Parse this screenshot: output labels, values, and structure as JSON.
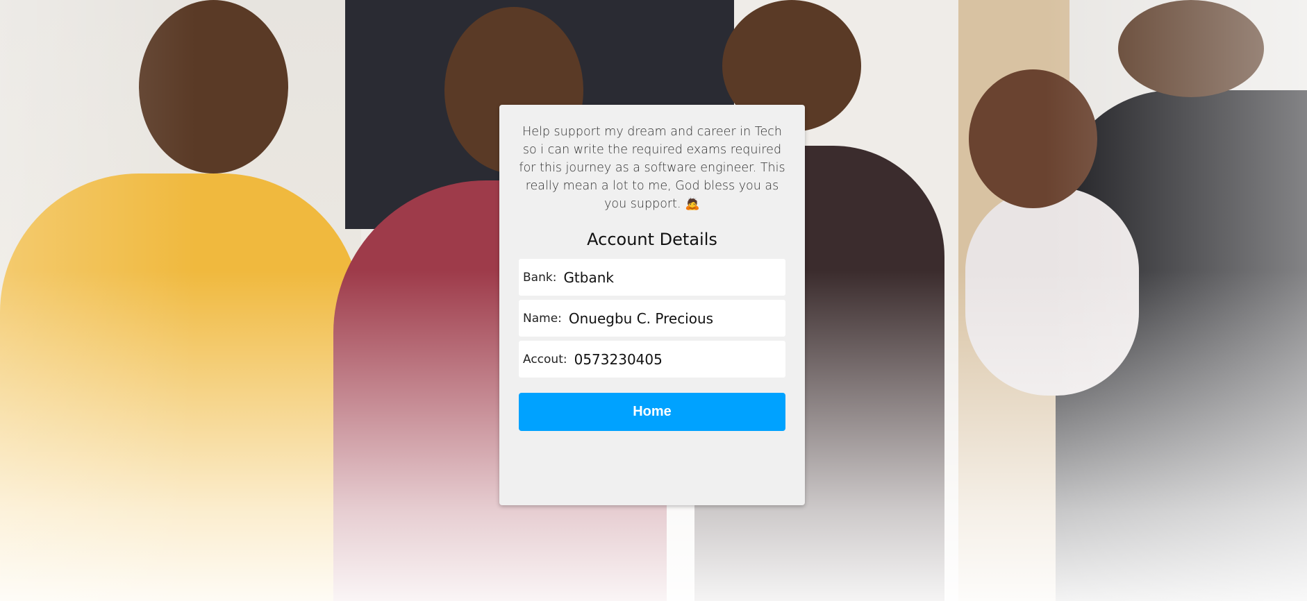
{
  "support_message": "Help support my dream and career in Tech so i can write the required exams required for this journey as a software engineer. This really mean a lot to me, God bless you as you support. 🙇",
  "account": {
    "title": "Account Details",
    "fields": [
      {
        "label": "Bank:",
        "value": "Gtbank"
      },
      {
        "label": "Name:",
        "value": "Onuegbu C. Precious"
      },
      {
        "label": "Accout:",
        "value": "0573230405"
      }
    ]
  },
  "home_button_label": "Home",
  "colors": {
    "card_background": "#f0f0f0",
    "button": "#00a2ff"
  }
}
